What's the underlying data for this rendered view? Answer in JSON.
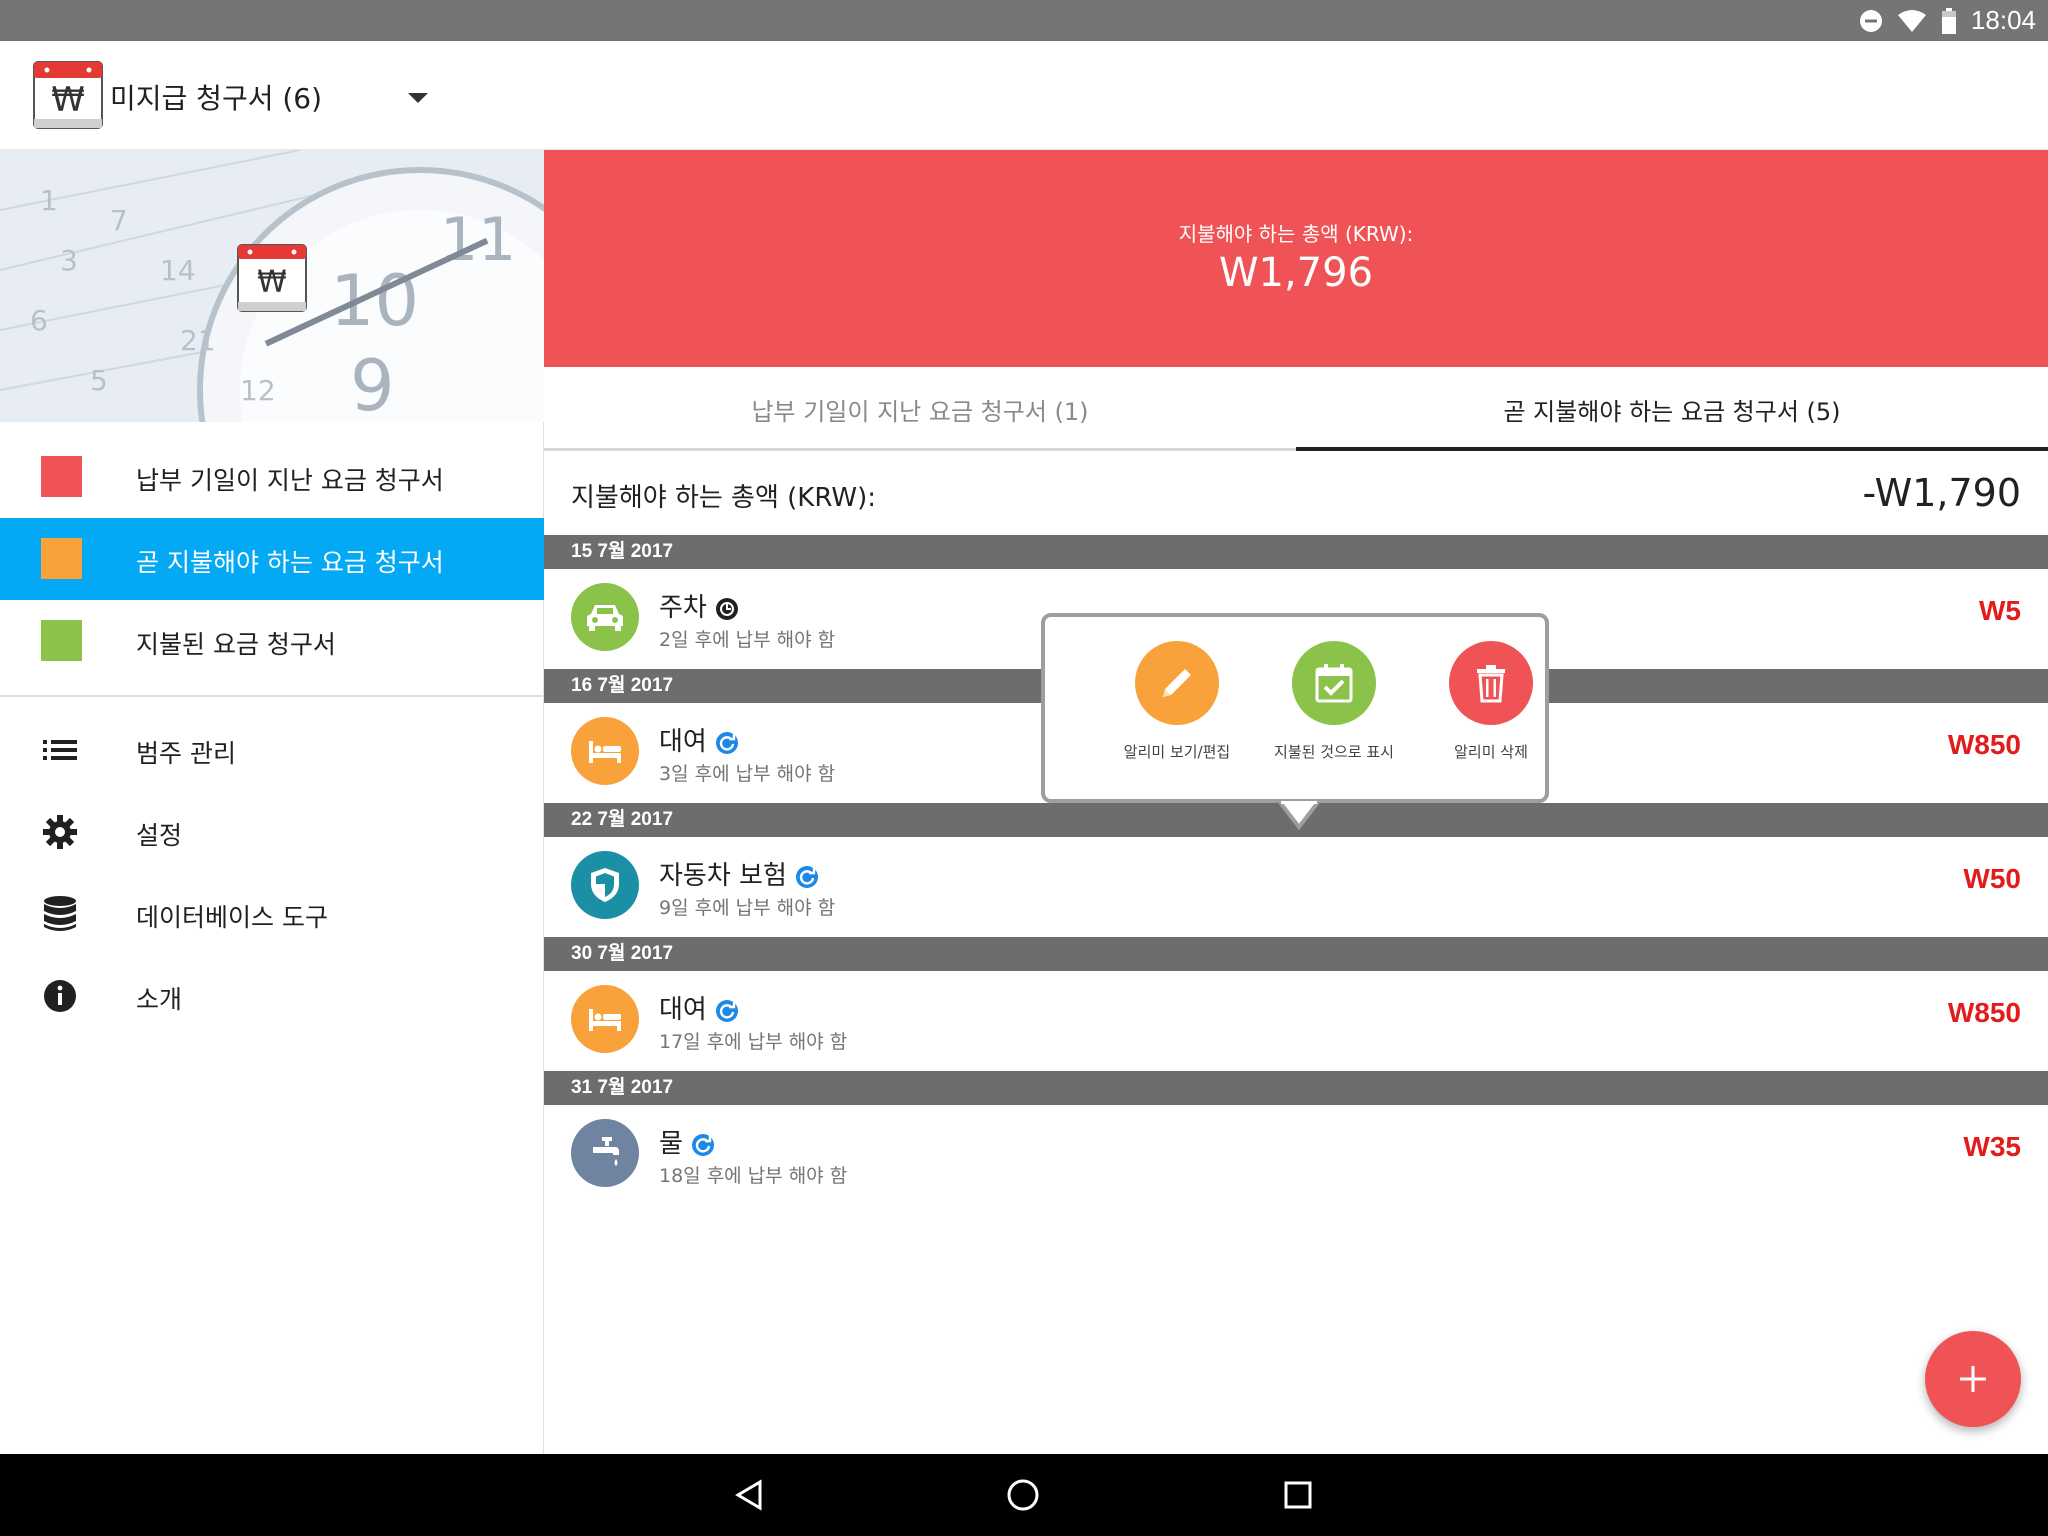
{
  "status_bar": {
    "time": "18:04",
    "icons": [
      "do-not-disturb-icon",
      "wifi-icon",
      "battery-icon"
    ]
  },
  "app_bar": {
    "title": "미지급 청구서 (6)"
  },
  "drawer": {
    "items": [
      {
        "label": "납부 기일이 지난 요금 청구서",
        "color": "#f05356",
        "active": false
      },
      {
        "label": "곧 지불해야 하는 요금 청구서",
        "color": "#f9a23b",
        "active": true
      },
      {
        "label": "지불된 요금 청구서",
        "color": "#8bc34a",
        "active": false
      }
    ],
    "tools": [
      {
        "label": "범주 관리",
        "icon": "list-icon"
      },
      {
        "label": "설정",
        "icon": "gear-icon"
      },
      {
        "label": "데이터베이스 도구",
        "icon": "database-icon"
      },
      {
        "label": "소개",
        "icon": "info-icon"
      }
    ]
  },
  "summary": {
    "label": "지불해야 하는 총액 (KRW):",
    "amount": "W1,796"
  },
  "tabs": [
    {
      "label": "납부 기일이 지난 요금 청구서 (1)",
      "active": false
    },
    {
      "label": "곧 지불해야 하는 요금 청구서 (5)",
      "active": true
    }
  ],
  "total_row": {
    "label": "지불해야 하는 총액 (KRW):",
    "value": "-W1,790"
  },
  "bills": [
    {
      "date": "15 7월 2017",
      "name": "주차",
      "due": "2일 후에 납부 해야 함",
      "amount": "W5",
      "icon": "car-icon",
      "icon_color": "#8bc34a",
      "badge": "once-badge-icon"
    },
    {
      "date": "16 7월 2017",
      "name": "대여",
      "due": "3일 후에 납부 해야 함",
      "amount": "W850",
      "icon": "bed-icon",
      "icon_color": "#f9a23b",
      "badge": "repeat-badge-icon"
    },
    {
      "date": "22 7월 2017",
      "name": "자동차 보험",
      "due": "9일 후에 납부 해야 함",
      "amount": "W50",
      "icon": "shield-icon",
      "icon_color": "#1b8fa4",
      "badge": "repeat-badge-icon"
    },
    {
      "date": "30 7월 2017",
      "name": "대여",
      "due": "17일 후에 납부 해야 함",
      "amount": "W850",
      "icon": "bed-icon",
      "icon_color": "#f9a23b",
      "badge": "repeat-badge-icon"
    },
    {
      "date": "31 7월 2017",
      "name": "물",
      "due": "18일 후에 납부 해야 함",
      "amount": "W35",
      "icon": "faucet-icon",
      "icon_color": "#6f84a0",
      "badge": "repeat-badge-icon"
    }
  ],
  "popup": {
    "actions": [
      {
        "label": "알리미 보기/편집",
        "icon": "pencil-icon",
        "color": "#f9a23b"
      },
      {
        "label": "지불된 것으로 표시",
        "icon": "calendar-check-icon",
        "color": "#8bc34a"
      },
      {
        "label": "알리미 삭제",
        "icon": "trash-icon",
        "color": "#f05356"
      }
    ]
  },
  "fab": {
    "icon": "plus-icon"
  },
  "nav_bar": {
    "buttons": [
      "back-icon",
      "home-icon",
      "recents-icon"
    ]
  },
  "colors": {
    "accent": "#03a9f4",
    "banner": "#f05356",
    "amount_red": "#e31b1b",
    "date_header": "#6d6d6d"
  }
}
